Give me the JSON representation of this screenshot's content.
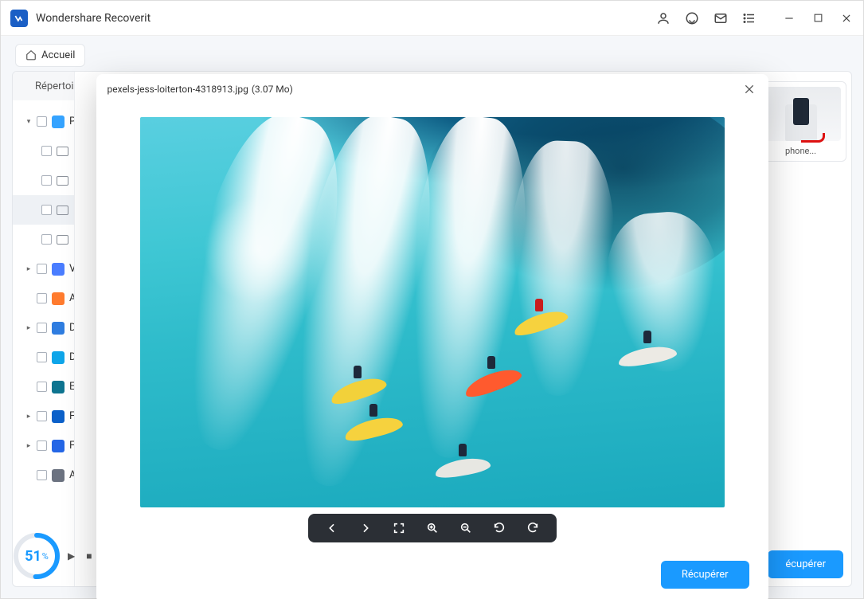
{
  "app": {
    "title": "Wondershare Recoverit"
  },
  "breadcrumb": {
    "home": "Accueil"
  },
  "sidebar": {
    "header": "Répertoi",
    "groups": [
      {
        "label": "P",
        "icon": "img",
        "children": 4
      },
      {
        "label": "V",
        "icon": "vid"
      },
      {
        "label": "A",
        "icon": "aud"
      },
      {
        "label": "D",
        "icon": "doc"
      },
      {
        "label": "D",
        "icon": "db"
      },
      {
        "label": "E",
        "icon": "em"
      },
      {
        "label": "F",
        "icon": "pk"
      },
      {
        "label": "F",
        "icon": "wb"
      },
      {
        "label": "A",
        "icon": "ra"
      }
    ]
  },
  "thumb": {
    "name": "phone..."
  },
  "progress": {
    "percent": 51,
    "unit": "%"
  },
  "buttons": {
    "recover_bg": "écupérer",
    "recover_modal": "Récupérer"
  },
  "modal": {
    "filename": "pexels-jess-loiterton-4318913.jpg",
    "filesize": "(3.07 Mo)"
  }
}
